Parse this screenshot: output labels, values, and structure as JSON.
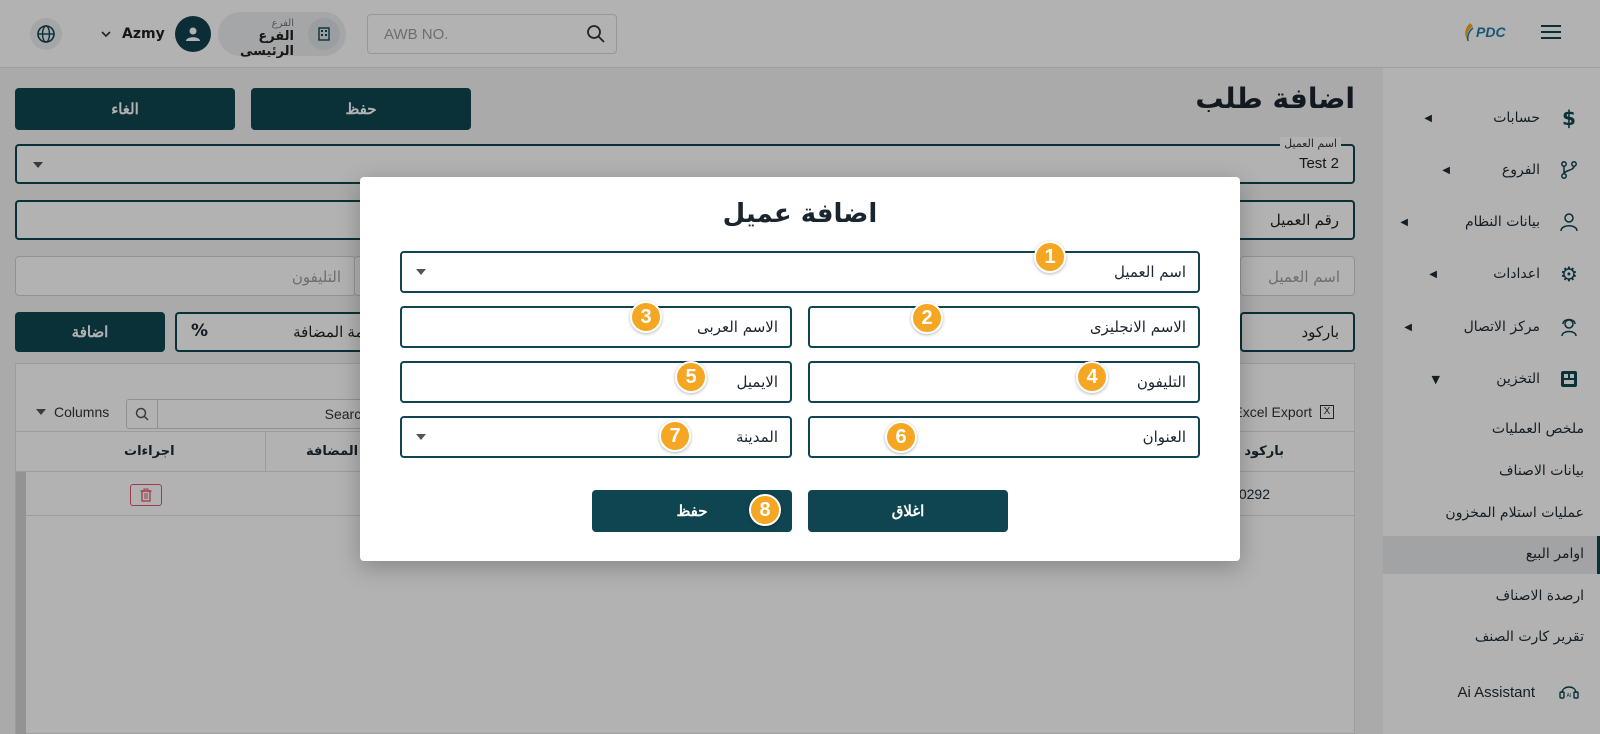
{
  "topbar": {
    "user_name": "Azmy",
    "branch_caption": "الفرع",
    "branch_value": "الفرع الرئيسى",
    "awb_placeholder": "AWB NO.",
    "logo_text": "PDC"
  },
  "sidebar": {
    "items": [
      {
        "label": "حسابات",
        "icon": "dollar-icon"
      },
      {
        "label": "الفروع",
        "icon": "branch-icon"
      },
      {
        "label": "بيانات النظام",
        "icon": "user-icon"
      },
      {
        "label": "اعدادات",
        "icon": "gear-icon"
      },
      {
        "label": "مركز الاتصال",
        "icon": "agent-icon"
      },
      {
        "label": "التخزين",
        "icon": "storage-icon"
      }
    ],
    "sub_items": [
      {
        "label": "ملخص العمليات"
      },
      {
        "label": "بيانات الاصناف"
      },
      {
        "label": "عمليات استلام المخزون"
      },
      {
        "label": "اوامر البيع",
        "active": true
      },
      {
        "label": "ارصدة الاصناف"
      },
      {
        "label": "تقرير كارت الصنف"
      }
    ],
    "assistant": "Ai Assistant"
  },
  "page": {
    "title": "اضافة طلب",
    "save_label": "حفظ",
    "cancel_label": "الغاء",
    "customer_name_caption": "اسم العميل",
    "customer_name_value": "Test 2",
    "customer_number_label": "رقم العميل",
    "name_placeholder": "اسم العميل",
    "phone_placeholder": "التليفون",
    "barcode_label": "باركود",
    "vat_label": "القيمة المضافة",
    "percent_symbol": "%",
    "add_label": "اضافة",
    "table": {
      "search_label": "Search",
      "columns_label": "Columns",
      "export_label": "Excel Export",
      "headers": [
        "باركود",
        "المضافة",
        "اجراءات"
      ],
      "row_barcode": "0292"
    }
  },
  "modal": {
    "title": "اضافة عميل",
    "fields": {
      "customer_name": "اسم العميل",
      "english_name": "الاسم الانجليزى",
      "arabic_name": "الاسم العربى",
      "phone": "التليفون",
      "email": "الايميل",
      "address": "العنوان",
      "city": "المدينة"
    },
    "save_label": "حفظ",
    "close_label": "اغلاق",
    "badges": [
      "1",
      "2",
      "3",
      "4",
      "5",
      "6",
      "7",
      "8"
    ]
  },
  "colors": {
    "primary": "#0f4551",
    "badge": "#f5a623"
  }
}
